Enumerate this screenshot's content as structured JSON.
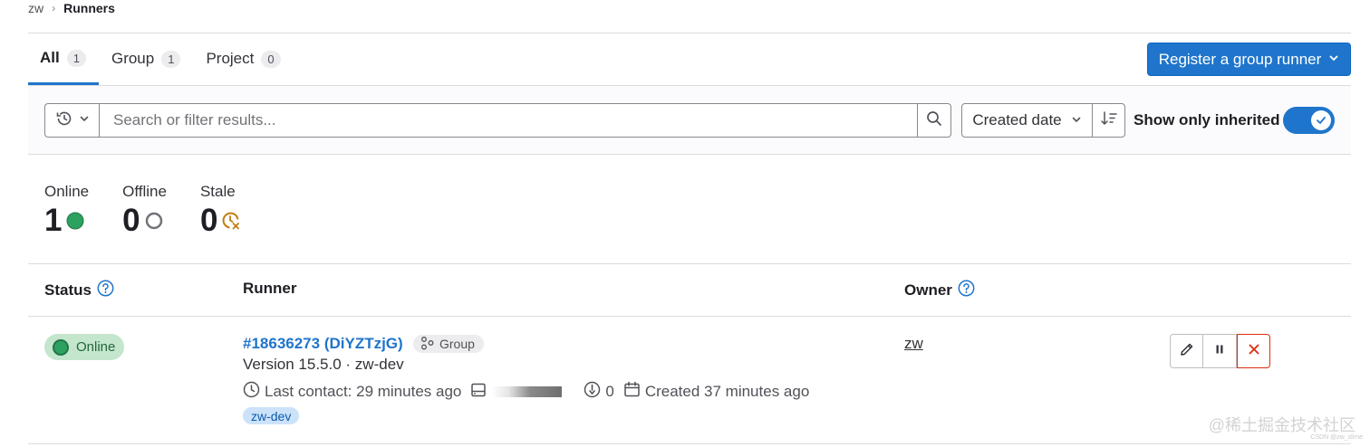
{
  "breadcrumb": {
    "parent": "zw",
    "current": "Runners"
  },
  "tabs": [
    {
      "label": "All",
      "count": "1"
    },
    {
      "label": "Group",
      "count": "1"
    },
    {
      "label": "Project",
      "count": "0"
    }
  ],
  "register_button": {
    "label": "Register a group runner",
    "icon": "chevron-down-icon"
  },
  "filter": {
    "search_placeholder": "Search or filter results...",
    "sort_label": "Created date",
    "show_inherited_label": "Show only inherited",
    "show_inherited_on": true
  },
  "stats": {
    "online": {
      "label": "Online",
      "value": "1"
    },
    "offline": {
      "label": "Offline",
      "value": "0"
    },
    "stale": {
      "label": "Stale",
      "value": "0"
    }
  },
  "table": {
    "headers": {
      "status": "Status",
      "runner": "Runner",
      "owner": "Owner"
    },
    "rows": [
      {
        "status": "Online",
        "runner_id": "#18636273 (DiYZTzjG)",
        "type_badge": "Group",
        "version": "Version 15.5.0 · zw-dev",
        "last_contact": "Last contact: 29 minutes ago",
        "jobs": "0",
        "created": "Created 37 minutes ago",
        "tag": "zw-dev",
        "owner": "zw"
      }
    ]
  },
  "watermark": {
    "text": "@稀土掘金技术社区",
    "small": "CSDN @zw_slime"
  },
  "colors": {
    "accent": "#1f75cb",
    "online": "#2da160",
    "danger": "#dd2b0e",
    "stale": "#c17d10"
  }
}
